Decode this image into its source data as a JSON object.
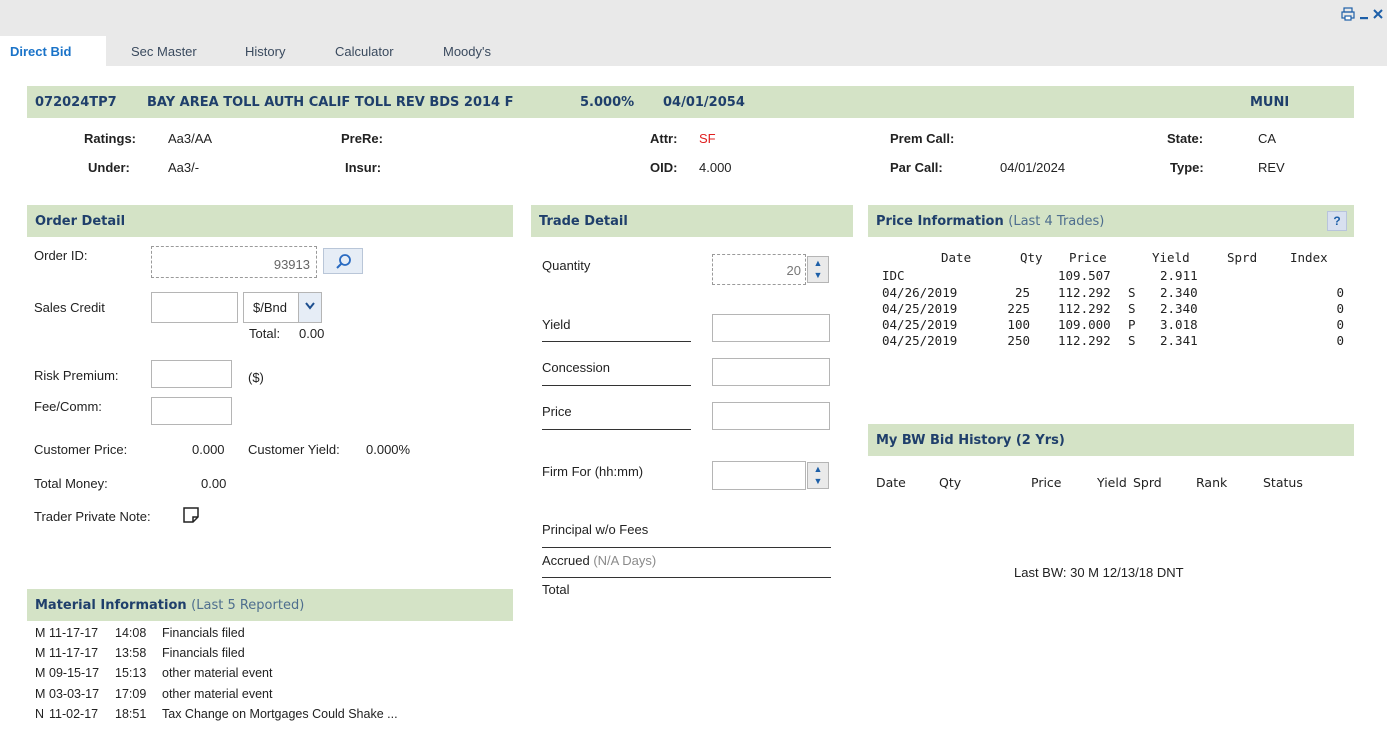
{
  "tabs": [
    "Direct Bid",
    "Sec Master",
    "History",
    "Calculator",
    "Moody's"
  ],
  "header": {
    "cusip": "072024TP7",
    "description": "BAY AREA TOLL AUTH CALIF TOLL REV BDS 2014 F",
    "coupon": "5.000%",
    "maturity": "04/01/2054",
    "sector": "MUNI"
  },
  "sec": {
    "ratings_label": "Ratings:",
    "ratings": "Aa3/AA",
    "prere_label": "PreRe:",
    "prere": "",
    "attr_label": "Attr:",
    "attr": "SF",
    "premcall_label": "Prem Call:",
    "premcall": "",
    "state_label": "State:",
    "state": "CA",
    "under_label": "Under:",
    "under": "Aa3/-",
    "insur_label": "Insur:",
    "insur": "",
    "oid_label": "OID:",
    "oid": "4.000",
    "parcall_label": "Par Call:",
    "parcall": "04/01/2024",
    "type_label": "Type:",
    "type": "REV"
  },
  "order": {
    "title": "Order Detail",
    "order_id_label": "Order ID:",
    "order_id": "93913",
    "sales_credit_label": "Sales Credit",
    "sales_credit_value": "",
    "unit": "$/Bnd",
    "total_label": "Total:",
    "total": "0.00",
    "risk_label": "Risk Premium:",
    "risk_unit": "($)",
    "fee_label": "Fee/Comm:",
    "cust_price_label": "Customer Price:",
    "cust_price": "0.000",
    "cust_yield_label": "Customer Yield:",
    "cust_yield": "0.000%",
    "total_money_label": "Total Money:",
    "total_money": "0.00",
    "note_label": "Trader Private Note:"
  },
  "trade": {
    "title": "Trade Detail",
    "quantity_label": "Quantity",
    "quantity": "20",
    "yield_label": "Yield",
    "concession_label": "Concession",
    "price_label": "Price",
    "firm_label": "Firm For (hh:mm)",
    "principal_label": "Principal w/o Fees",
    "accrued_label": "Accrued",
    "accrued_days": "(N/A Days)",
    "total_label": "Total"
  },
  "price_info": {
    "title": "Price Information",
    "subtitle": "(Last 4 Trades)",
    "columns": [
      "Date",
      "Qty",
      "Price",
      "Yield",
      "Sprd",
      "Index"
    ],
    "rows": [
      {
        "date": "IDC",
        "qty": "",
        "price": "109.507",
        "flag": "",
        "yield": "2.911",
        "sprd": "",
        "index": ""
      },
      {
        "date": "04/26/2019",
        "qty": "25",
        "price": "112.292",
        "flag": "S",
        "yield": "2.340",
        "sprd": "",
        "index": "0"
      },
      {
        "date": "04/25/2019",
        "qty": "225",
        "price": "112.292",
        "flag": "S",
        "yield": "2.340",
        "sprd": "",
        "index": "0"
      },
      {
        "date": "04/25/2019",
        "qty": "100",
        "price": "109.000",
        "flag": "P",
        "yield": "3.018",
        "sprd": "",
        "index": "0"
      },
      {
        "date": "04/25/2019",
        "qty": "250",
        "price": "112.292",
        "flag": "S",
        "yield": "2.341",
        "sprd": "",
        "index": "0"
      }
    ]
  },
  "bw": {
    "title": "My BW Bid History (2 Yrs)",
    "columns": [
      "Date",
      "Qty",
      "Price",
      "Yield",
      "Sprd",
      "Rank",
      "Status"
    ],
    "last_bw": "Last BW: 30 M 12/13/18 DNT"
  },
  "material": {
    "title": "Material Information",
    "subtitle": "(Last 5 Reported)",
    "rows": [
      {
        "code": "M",
        "date": "11-17-17",
        "time": "14:08",
        "text": "Financials filed"
      },
      {
        "code": "M",
        "date": "11-17-17",
        "time": "13:58",
        "text": "Financials filed"
      },
      {
        "code": "M",
        "date": "09-15-17",
        "time": "15:13",
        "text": "other material event"
      },
      {
        "code": "M",
        "date": "03-03-17",
        "time": "17:09",
        "text": "other material event"
      },
      {
        "code": "N",
        "date": "11-02-17",
        "time": "18:51",
        "text": "Tax Change on Mortgages Could Shake ..."
      }
    ]
  }
}
